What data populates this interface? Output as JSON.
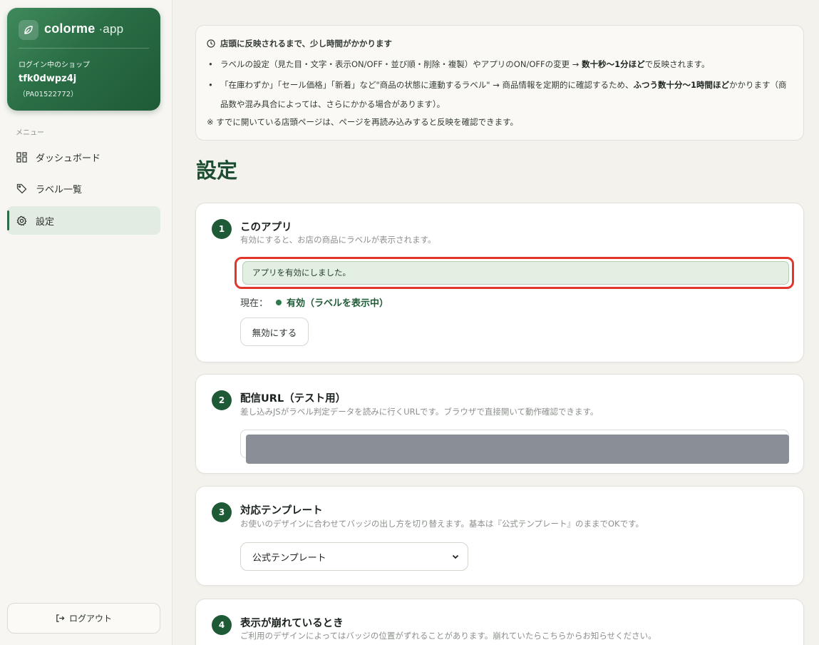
{
  "brand": {
    "name": "colorme",
    "suffix": "·app",
    "shop_label": "ログイン中のショップ",
    "shop_id": "tfk0dwpz4j",
    "shop_code": "（PA01522772）"
  },
  "sidebar": {
    "menu_label": "メニュー",
    "items": [
      {
        "label": "ダッシュボード",
        "icon": "dashboard-icon"
      },
      {
        "label": "ラベル一覧",
        "icon": "tag-icon"
      },
      {
        "label": "設定",
        "icon": "gear-icon",
        "active": true
      }
    ],
    "logout_label": "ログアウト"
  },
  "notice": {
    "title": "店頭に反映されるまで、少し時間がかかります",
    "item1_pre": "ラベルの設定（見た目・文字・表示ON/OFF・並び順・削除・複製）やアプリのON/OFFの変更 → ",
    "item1_bold": "数十秒〜1分ほど",
    "item1_post": "で反映されます。",
    "item2_pre": "「在庫わずか」「セール価格」「新着」など\"商品の状態に連動するラベル\" → 商品情報を定期的に確認するため、",
    "item2_bold": "ふつう数十分〜1時間ほど",
    "item2_post": "かかります（商品数や混み具合によっては、さらにかかる場合があります）。",
    "footer": "※ すでに開いている店頭ページは、ページを再読み込みすると反映を確認できます。"
  },
  "page_title": "設定",
  "cards": {
    "app": {
      "num": "1",
      "title": "このアプリ",
      "desc": "有効にすると、お店の商品にラベルが表示されます。",
      "success": "アプリを有効にしました。",
      "status_label": "現在：",
      "status_value": "有効（ラベルを表示中）",
      "button": "無効にする"
    },
    "url": {
      "num": "2",
      "title": "配信URL（テスト用）",
      "desc": "差し込みJSがラベル判定データを読みに行くURLです。ブラウザで直接開いて動作確認できます。"
    },
    "template": {
      "num": "3",
      "title": "対応テンプレート",
      "desc": "お使いのデザインに合わせてバッジの出し方を切り替えます。基本は『公式テンプレート』のままでOKです。",
      "selected": "公式テンプレート"
    },
    "display": {
      "num": "4",
      "title": "表示が崩れているとき",
      "desc": "ご利用のデザインによってはバッジの位置がずれることがあります。崩れていたらこちらからお知らせください。"
    }
  },
  "colors": {
    "brand_green": "#1f5a36",
    "success_bg": "#e4efe4",
    "highlight_red": "#e0362b"
  }
}
